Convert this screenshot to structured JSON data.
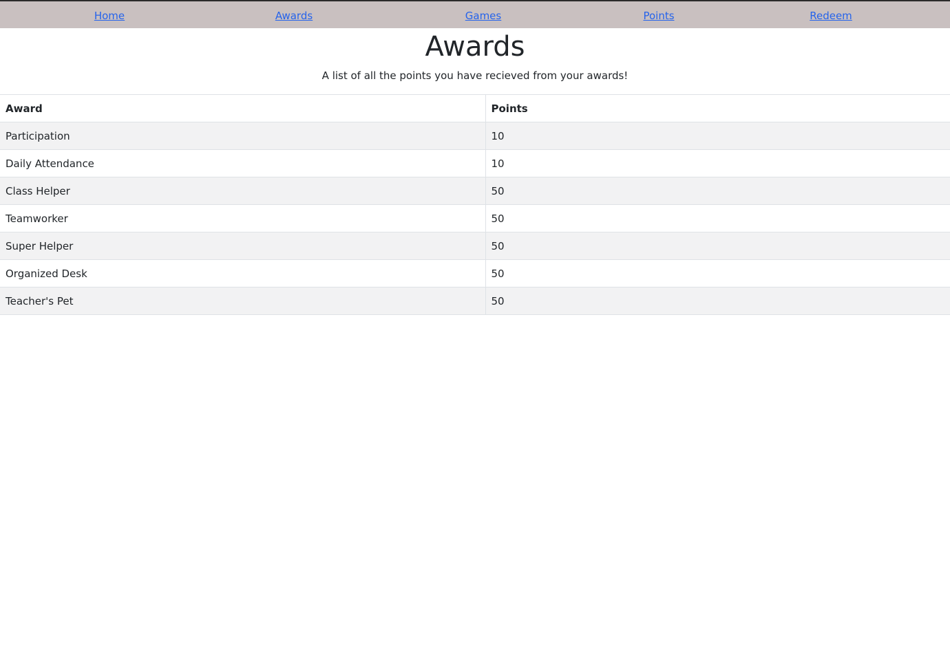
{
  "nav": {
    "items": [
      {
        "label": "Home"
      },
      {
        "label": "Awards"
      },
      {
        "label": "Games"
      },
      {
        "label": "Points"
      },
      {
        "label": "Redeem"
      }
    ]
  },
  "page": {
    "title": "Awards",
    "subtitle": "A list of all the points you have recieved from your awards!"
  },
  "table": {
    "headers": [
      "Award",
      "Points"
    ],
    "rows": [
      {
        "award": "Participation",
        "points": "10"
      },
      {
        "award": "Daily Attendance",
        "points": "10"
      },
      {
        "award": "Class Helper",
        "points": "50"
      },
      {
        "award": "Teamworker",
        "points": "50"
      },
      {
        "award": "Super Helper",
        "points": "50"
      },
      {
        "award": "Organized Desk",
        "points": "50"
      },
      {
        "award": "Teacher's Pet",
        "points": "50"
      }
    ]
  },
  "colors": {
    "nav_background": "#c9c0c0",
    "link": "#2563eb",
    "striped_row": "#f2f2f3"
  }
}
